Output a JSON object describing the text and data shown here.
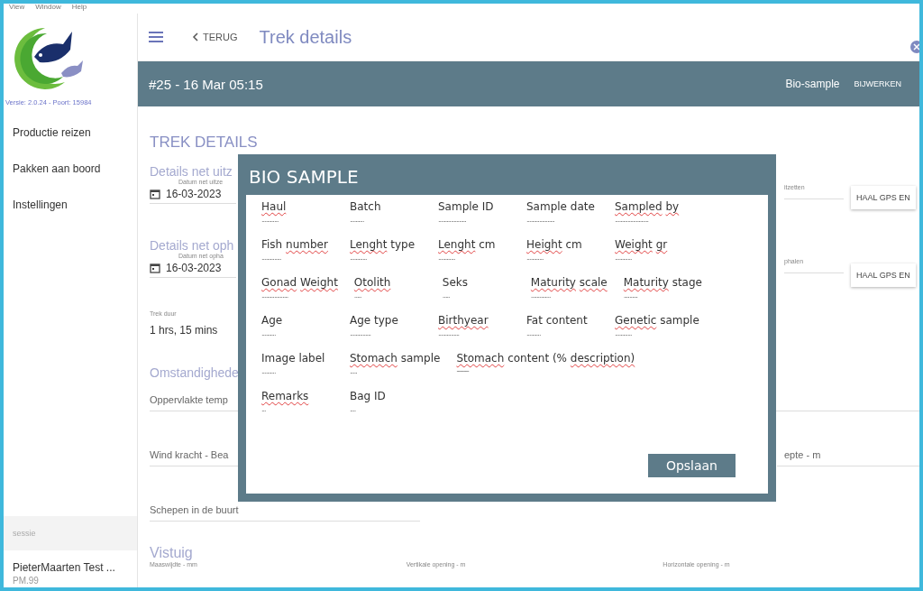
{
  "menu_bar": [
    "View",
    "Window",
    "Help"
  ],
  "sidebar": {
    "version": "Versie: 2.0.24 - Poort: 15984",
    "items": [
      {
        "label": "Productie reizen"
      },
      {
        "label": "Pakken aan boord"
      },
      {
        "label": "Instellingen"
      }
    ],
    "session_label": "sessie",
    "user": "PieterMaarten Test ...",
    "user_code": "PM.99"
  },
  "header": {
    "back": "TERUG",
    "title": "Trek details"
  },
  "trip_bar": {
    "title": "#25 - 16 Mar 05:15",
    "actions": [
      "Bio-sample",
      "BIJWERKEN"
    ]
  },
  "form": {
    "heading": "TREK DETAILS",
    "net_sections": [
      {
        "section": "Details net uitz",
        "date_label": "Datum net uitze",
        "date": "16-03-2023",
        "right_label": "itzetten",
        "gps_button": "HAAL GPS EN"
      },
      {
        "section": "Details net oph",
        "date_label": "Datum net opha",
        "date": "16-03-2023",
        "right_label": "phalen",
        "gps_button": "HAAL GPS EN"
      }
    ],
    "duration_label": "Trek duur",
    "duration": "1 hrs, 15 mins",
    "conditions": "Omstandighede",
    "surface_temp": "Oppervlakte temp",
    "wind": "Wind kracht - Bea",
    "depth": "epte - m",
    "ships": "Schepen in de buurt",
    "gear": {
      "title": "Vistuig",
      "labels": [
        "Maaswijdte - mm",
        "Vertikale opening - m",
        "Horizontale opening - m"
      ]
    }
  },
  "modal": {
    "title": "BIO SAMPLE",
    "rows": [
      [
        {
          "words": [
            {
              "text": "Haul",
              "flagged": true
            }
          ],
          "value": "............"
        },
        {
          "words": [
            {
              "text": "Batch",
              "flagged": false
            }
          ],
          "value": ".........."
        },
        {
          "words": [
            {
              "text": "Sample",
              "flagged": false
            },
            {
              "text": "ID",
              "flagged": false
            }
          ],
          "value": "...................."
        },
        {
          "words": [
            {
              "text": "Sample",
              "flagged": false
            },
            {
              "text": "date",
              "flagged": false
            }
          ],
          "value": "...................."
        },
        {
          "words": [
            {
              "text": "Sampled",
              "flagged": true
            },
            {
              "text": "by",
              "flagged": true
            }
          ],
          "value": "........................"
        }
      ],
      [
        {
          "words": [
            {
              "text": "Fish",
              "flagged": false
            },
            {
              "text": "number",
              "flagged": true
            }
          ],
          "value": ".............."
        },
        {
          "words": [
            {
              "text": "Lenght",
              "flagged": true
            },
            {
              "text": "type",
              "flagged": false
            }
          ],
          "value": "............"
        },
        {
          "words": [
            {
              "text": "Lenght",
              "flagged": true
            },
            {
              "text": "cm",
              "flagged": false
            }
          ],
          "value": "............"
        },
        {
          "words": [
            {
              "text": "Height",
              "flagged": true
            },
            {
              "text": "cm",
              "flagged": false
            }
          ],
          "value": "............"
        },
        {
          "words": [
            {
              "text": "Weight",
              "flagged": true
            },
            {
              "text": "gr",
              "flagged": true
            }
          ],
          "value": "............"
        }
      ],
      [
        {
          "words": [
            {
              "text": "Gonad",
              "flagged": true
            },
            {
              "text": "Weight",
              "flagged": true
            }
          ],
          "value": "..................."
        },
        {
          "words": [
            {
              "text": "Otolith",
              "flagged": true
            }
          ],
          "value": "....."
        },
        {
          "words": [
            {
              "text": "Seks",
              "flagged": false
            }
          ],
          "value": "....."
        },
        {
          "words": [
            {
              "text": "Maturity",
              "flagged": true
            },
            {
              "text": "scale",
              "flagged": true
            }
          ],
          "value": ".............."
        },
        {
          "words": [
            {
              "text": "Maturity",
              "flagged": true
            },
            {
              "text": "stage",
              "flagged": false
            }
          ],
          "value": ".........."
        }
      ],
      [
        {
          "words": [
            {
              "text": "Age",
              "flagged": false
            }
          ],
          "value": ".........."
        },
        {
          "words": [
            {
              "text": "Age",
              "flagged": false
            },
            {
              "text": "type",
              "flagged": false
            }
          ],
          "value": "..............."
        },
        {
          "words": [
            {
              "text": "Birthyear",
              "flagged": true
            }
          ],
          "value": "..............."
        },
        {
          "words": [
            {
              "text": "Fat",
              "flagged": false
            },
            {
              "text": "content",
              "flagged": false
            }
          ],
          "value": ".........."
        },
        {
          "words": [
            {
              "text": "Genetic",
              "flagged": true
            },
            {
              "text": "sample",
              "flagged": false
            }
          ],
          "value": "............"
        }
      ],
      [
        {
          "words": [
            {
              "text": "Image",
              "flagged": false
            },
            {
              "text": "label",
              "flagged": false
            }
          ],
          "value": ".........."
        },
        {
          "words": [
            {
              "text": "Stomach",
              "flagged": true
            },
            {
              "text": "sample",
              "flagged": false
            }
          ],
          "value": "....."
        },
        {
          "words": [
            {
              "text": "Stomach",
              "flagged": true
            },
            {
              "text": "content",
              "flagged": false
            },
            {
              "text": "(%",
              "flagged": false
            },
            {
              "text": "description)",
              "flagged": true
            }
          ],
          "value": "-------"
        }
      ],
      [
        {
          "words": [
            {
              "text": "Remarks",
              "flagged": true
            }
          ],
          "value": "..."
        },
        {
          "words": [
            {
              "text": "Bag",
              "flagged": false
            },
            {
              "text": "ID",
              "flagged": false
            }
          ],
          "value": "...."
        }
      ]
    ],
    "save": "Opslaan"
  }
}
